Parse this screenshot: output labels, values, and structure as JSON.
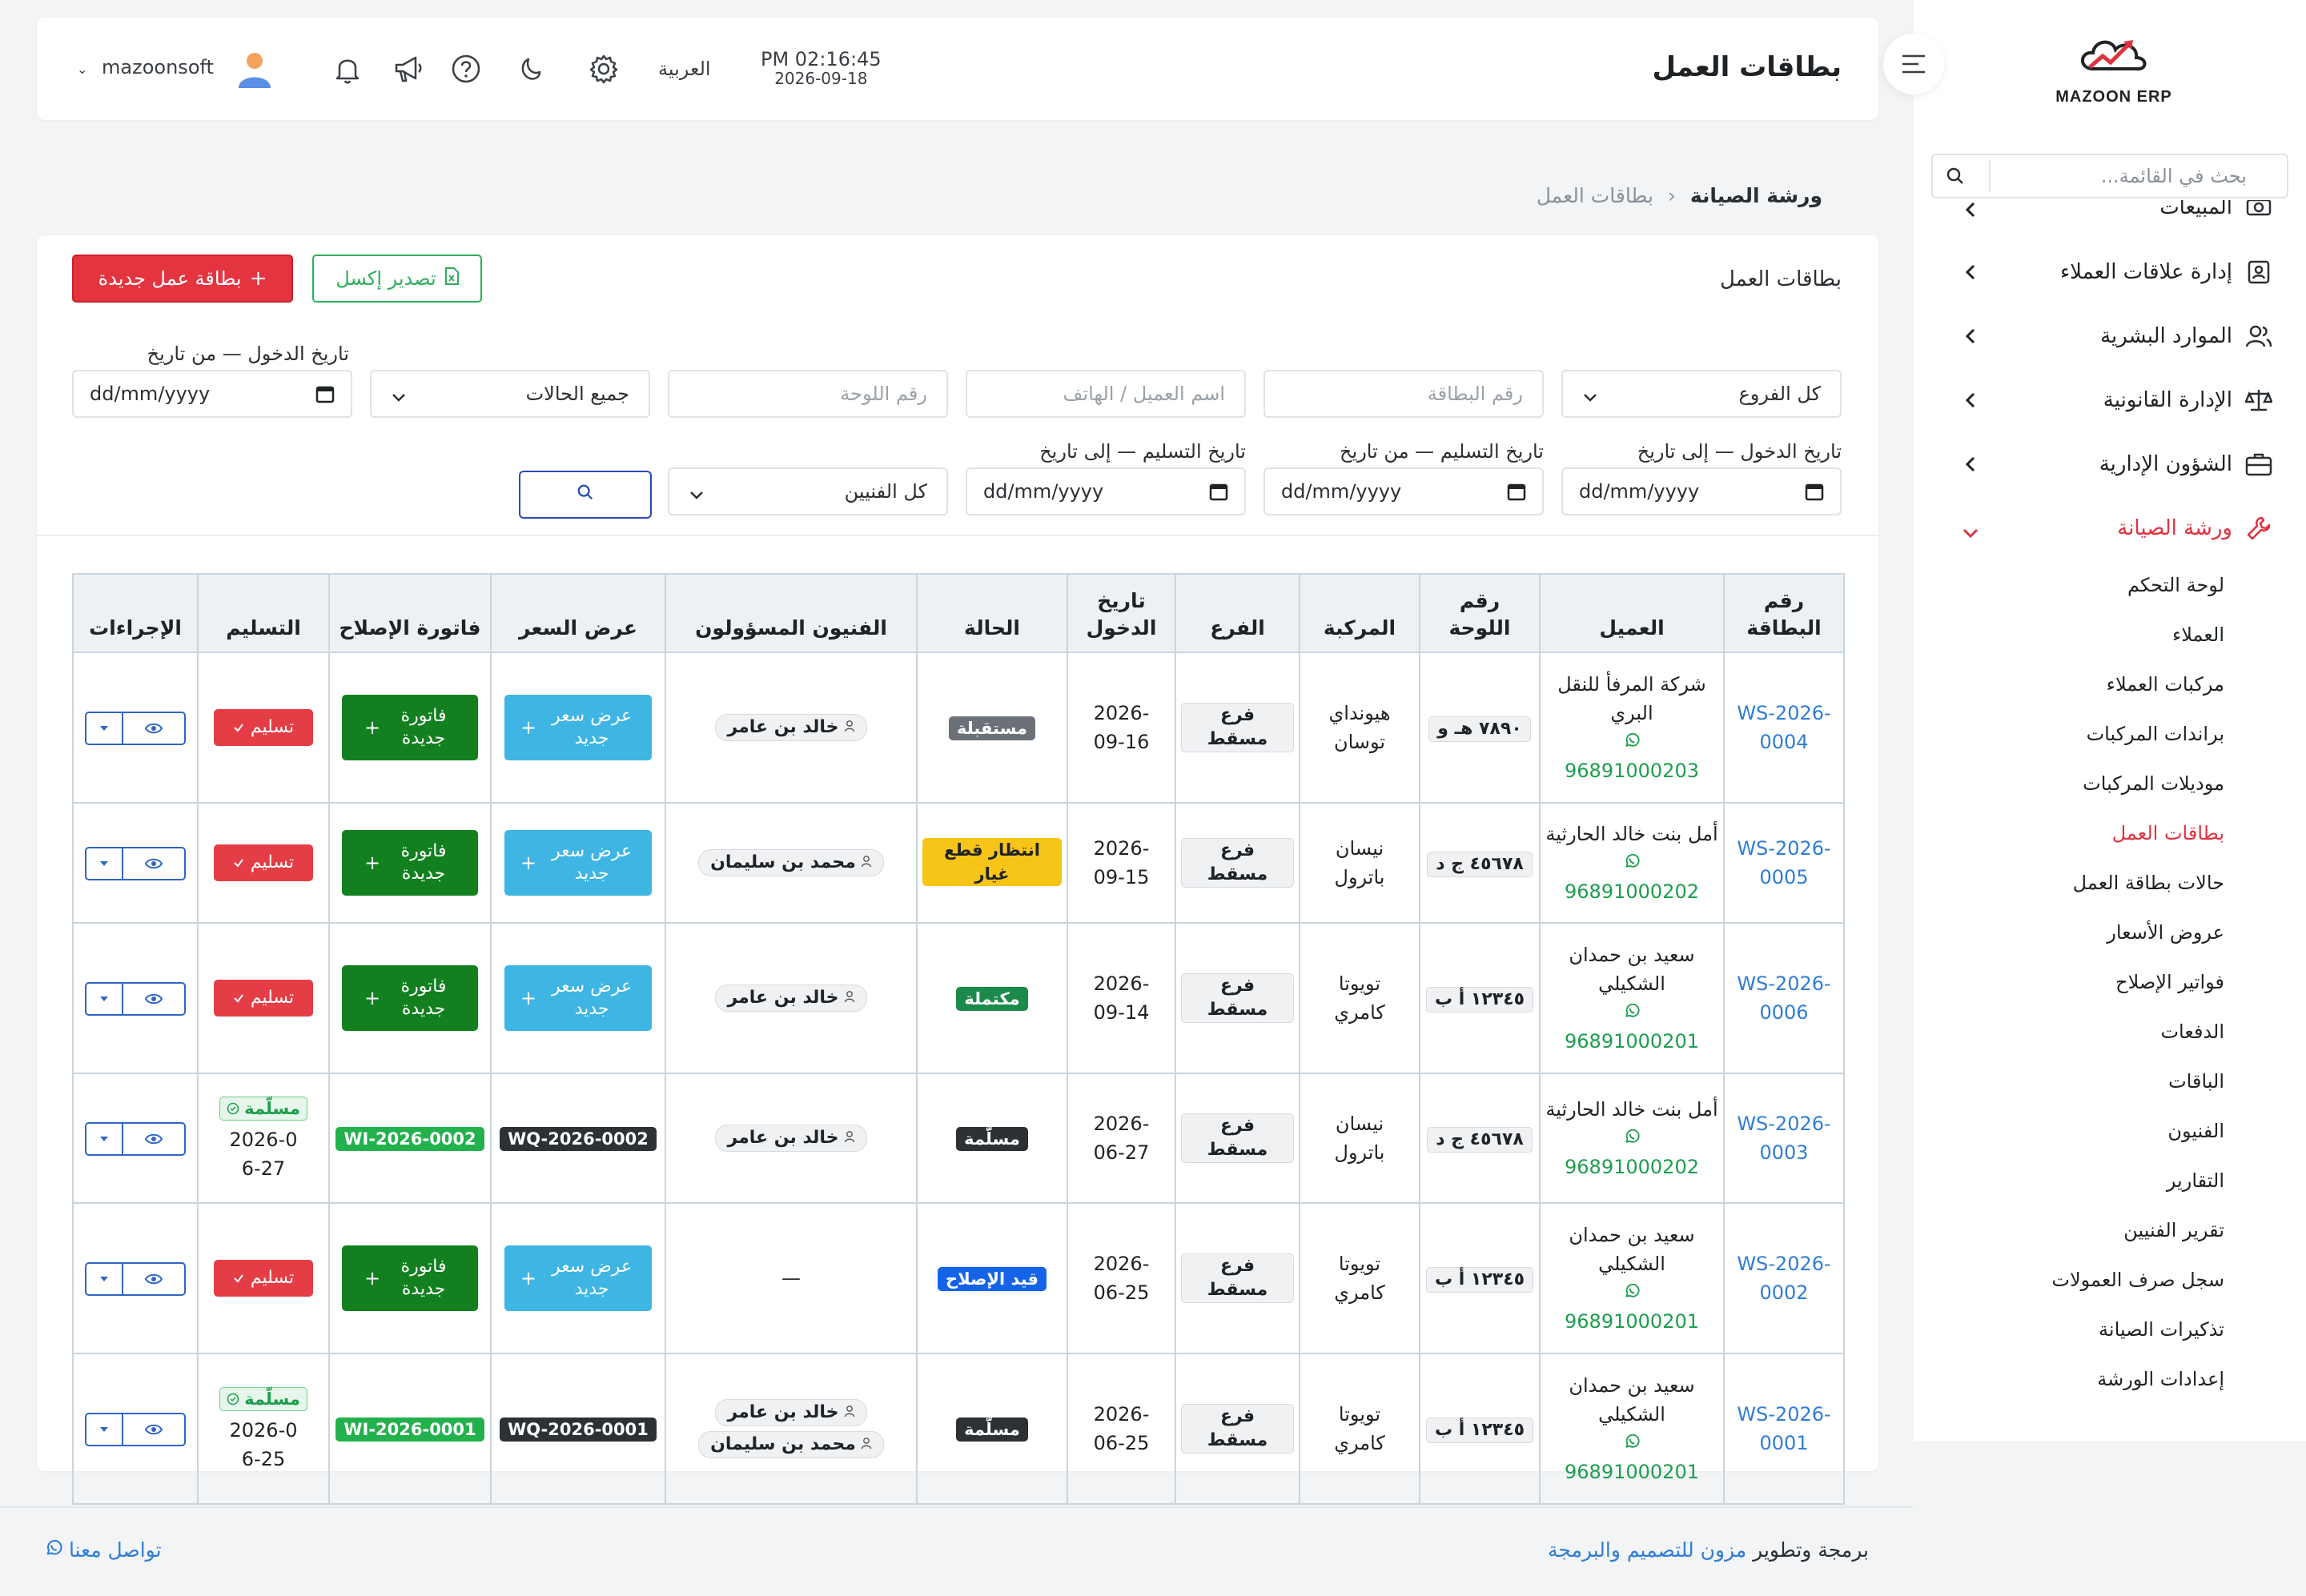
{
  "app": {
    "logo_text": "MAZOON ERP"
  },
  "header": {
    "title": "بطاقات العمل",
    "time": "PM 02:16:45",
    "date": "2026-09-18",
    "language": "العربية",
    "username": "mazoonsoft"
  },
  "sidebar": {
    "search_placeholder": "بحث في القائمة...",
    "items": [
      {
        "label": "المبيعات",
        "icon": "camera-icon"
      },
      {
        "label": "إدارة علاقات العملاء",
        "icon": "contacts-icon"
      },
      {
        "label": "الموارد البشرية",
        "icon": "users-icon"
      },
      {
        "label": "الإدارة القانونية",
        "icon": "scale-icon"
      },
      {
        "label": "الشؤون الإدارية",
        "icon": "briefcase-icon"
      },
      {
        "label": "ورشة الصيانة",
        "icon": "wrench-icon"
      }
    ],
    "subitems": [
      "لوحة التحكم",
      "العملاء",
      "مركبات العملاء",
      "براندات المركبات",
      "موديلات المركبات",
      "بطاقات العمل",
      "حالات بطاقة العمل",
      "عروض الأسعار",
      "فواتير الإصلاح",
      "الدفعات",
      "الباقات",
      "الفنيون",
      "التقارير",
      "تقرير الفنيين",
      "سجل صرف العمولات",
      "تذكيرات الصيانة",
      "إعدادات الورشة"
    ],
    "active_subitem": "بطاقات العمل",
    "accent_color": "#e0323f"
  },
  "breadcrumb": {
    "parent": "ورشة الصيانة",
    "current": "بطاقات العمل"
  },
  "card": {
    "title": "بطاقات العمل",
    "new_button": "بطاقة عمل جديدة",
    "export_button": "تصدير إكسل"
  },
  "filters": {
    "branch": "كل الفروع",
    "card_no_ph": "رقم البطاقة",
    "customer_ph": "اسم العميل / الهاتف",
    "plate_ph": "رقم اللوحة",
    "status": "جميع الحالات",
    "entry_from_label": "تاريخ الدخول — من تاريخ",
    "entry_to_label": "تاريخ الدخول — إلى تاريخ",
    "delivery_from_label": "تاريخ التسليم — من تاريخ",
    "delivery_to_label": "تاريخ التسليم — إلى تاريخ",
    "date_ph": "dd/mm/yyyy",
    "technicians": "كل الفنيين"
  },
  "table": {
    "headers": [
      "رقم البطاقة",
      "العميل",
      "رقم اللوحة",
      "المركبة",
      "الفرع",
      "تاريخ الدخول",
      "الحالة",
      "الفنيون المسؤولون",
      "عرض السعر",
      "فاتورة الإصلاح",
      "التسليم",
      "الإجراءات"
    ],
    "quote_btn": "عرض سعر جديد",
    "invoice_btn": "فاتورة جديدة",
    "deliver_btn": "تسليم",
    "delivered_label": "مسلّمة",
    "rows": [
      {
        "card": "WS-2026-0004",
        "customer": "شركة المرفأ للنقل البري",
        "phone": "96891000203",
        "plate": "٧٨٩٠ هـ و",
        "vehicle": "هيونداي توسان",
        "branch": "فرع مسقط",
        "date": "2026-09-16",
        "status": "مستقبلة",
        "status_color": "#6b7177",
        "techs": [
          "خالد بن عامر"
        ],
        "quote": null,
        "invoice": null,
        "delivery": null
      },
      {
        "card": "WS-2026-0005",
        "customer": "أمل بنت خالد الحارثية",
        "phone": "96891000202",
        "plate": "٤٥٦٧٨ ج د",
        "vehicle": "نيسان باترول",
        "branch": "فرع مسقط",
        "date": "2026-09-15",
        "status": "انتظار قطع غيار",
        "status_color": "#f7c418",
        "techs": [
          "محمد بن سليمان"
        ],
        "quote": null,
        "invoice": null,
        "delivery": null
      },
      {
        "card": "WS-2026-0006",
        "customer": "سعيد بن حمدان الشكيلي",
        "phone": "96891000201",
        "plate": "١٢٣٤٥ أ ب",
        "vehicle": "تويوتا كامري",
        "branch": "فرع مسقط",
        "date": "2026-09-14",
        "status": "مكتملة",
        "status_color": "#1c8a4a",
        "techs": [
          "خالد بن عامر"
        ],
        "quote": null,
        "invoice": null,
        "delivery": null
      },
      {
        "card": "WS-2026-0003",
        "customer": "أمل بنت خالد الحارثية",
        "phone": "96891000202",
        "plate": "٤٥٦٧٨ ج د",
        "vehicle": "نيسان باترول",
        "branch": "فرع مسقط",
        "date": "2026-06-27",
        "status": "مسلّمة",
        "status_color": "#2c3136",
        "techs": [
          "خالد بن عامر"
        ],
        "quote": "WQ-2026-0002",
        "invoice": "WI-2026-0002",
        "delivery": "2026-06-27"
      },
      {
        "card": "WS-2026-0002",
        "customer": "سعيد بن حمدان الشكيلي",
        "phone": "96891000201",
        "plate": "١٢٣٤٥ أ ب",
        "vehicle": "تويوتا كامري",
        "branch": "فرع مسقط",
        "date": "2026-06-25",
        "status": "قيد الإصلاح",
        "status_color": "#1463e8",
        "techs": [],
        "quote": null,
        "invoice": null,
        "delivery": null
      },
      {
        "card": "WS-2026-0001",
        "customer": "سعيد بن حمدان الشكيلي",
        "phone": "96891000201",
        "plate": "١٢٣٤٥ أ ب",
        "vehicle": "تويوتا كامري",
        "branch": "فرع مسقط",
        "date": "2026-06-25",
        "status": "مسلّمة",
        "status_color": "#2c3136",
        "techs": [
          "خالد بن عامر",
          "محمد بن سليمان"
        ],
        "quote": "WQ-2026-0001",
        "invoice": "WI-2026-0001",
        "delivery": "2026-06-25"
      }
    ]
  },
  "footer": {
    "prefix": "برمجة وتطوير",
    "brand": "مزون للتصميم والبرمجة",
    "contact": "تواصل معنا"
  }
}
